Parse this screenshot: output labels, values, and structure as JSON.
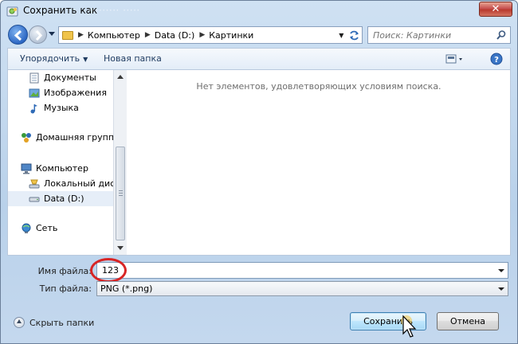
{
  "window": {
    "title": "Сохранить как",
    "title_ghost": "·········  ·····"
  },
  "icons": {
    "app": "save-as-app-icon",
    "close": "close-icon",
    "back": "back-arrow-icon",
    "forward": "forward-arrow-icon",
    "refresh": "refresh-icon",
    "search": "search-icon",
    "view": "view-options-icon",
    "help": "help-icon"
  },
  "address": {
    "crumbs": [
      "Компьютер",
      "Data (D:)",
      "Картинки"
    ]
  },
  "search": {
    "placeholder": "Поиск: Картинки"
  },
  "toolbar": {
    "organize": "Упорядочить",
    "new_folder": "Новая папка"
  },
  "nav": {
    "items": [
      {
        "label": "Документы",
        "icon": "documents-icon"
      },
      {
        "label": "Изображения",
        "icon": "pictures-icon"
      },
      {
        "label": "Музыка",
        "icon": "music-icon"
      },
      {
        "label": "Домашняя группа",
        "icon": "homegroup-icon"
      },
      {
        "label": "Компьютер",
        "icon": "computer-icon"
      },
      {
        "label": "Локальный диск",
        "icon": "local-disk-icon"
      },
      {
        "label": "Data (D:)",
        "icon": "drive-icon"
      },
      {
        "label": "Сеть",
        "icon": "network-icon"
      }
    ],
    "selected": "Data (D:)"
  },
  "content": {
    "empty_message": "Нет элементов, удовлетворяющих условиям поиска."
  },
  "form": {
    "filename_label": "Имя файла:",
    "filename_value": "123",
    "filetype_label": "Тип файла:",
    "filetype_value": "PNG (*.png)"
  },
  "footer": {
    "hide_folders": "Скрыть папки",
    "save": "Сохранить",
    "cancel": "Отмена"
  },
  "colors": {
    "highlight_circle": "#d82424",
    "accent": "#3c7fb1"
  }
}
